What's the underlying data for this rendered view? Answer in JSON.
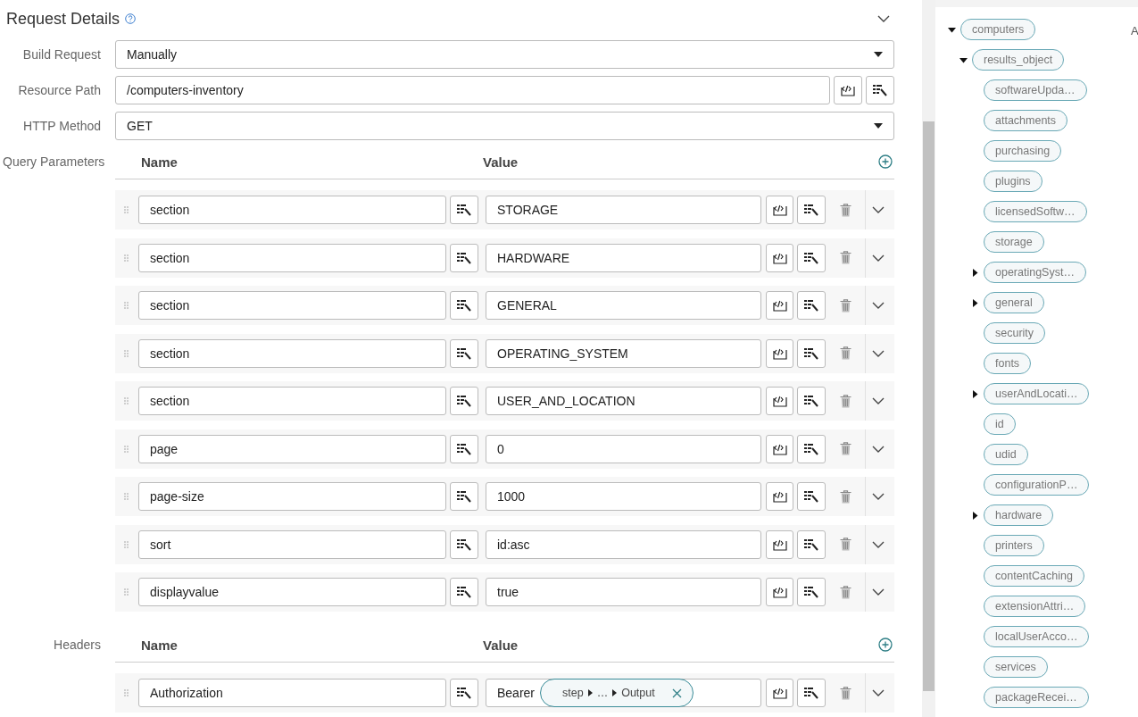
{
  "header": {
    "title": "Request Details",
    "expanded": true
  },
  "form": [
    {
      "label": "Build Request",
      "kind": "select",
      "value": "Manually"
    },
    {
      "label": "Resource Path",
      "kind": "text",
      "value": "/computers-inventory"
    },
    {
      "label": "HTTP Method",
      "kind": "select",
      "value": "GET"
    }
  ],
  "query_parameters": {
    "label": "Query Parameters",
    "columns": [
      "Name",
      "Value"
    ],
    "rows": [
      {
        "name": "section",
        "value": "STORAGE"
      },
      {
        "name": "section",
        "value": "HARDWARE"
      },
      {
        "name": "section",
        "value": "GENERAL"
      },
      {
        "name": "section",
        "value": "OPERATING_SYSTEM"
      },
      {
        "name": "section",
        "value": "USER_AND_LOCATION"
      },
      {
        "name": "page",
        "value": "0"
      },
      {
        "name": "page-size",
        "value": "1000"
      },
      {
        "name": "sort",
        "value": "id:asc"
      },
      {
        "name": "displayvalue",
        "value": "true"
      }
    ]
  },
  "headers": {
    "label": "Headers",
    "columns": [
      "Name",
      "Value"
    ],
    "rows": [
      {
        "name": "Authorization",
        "value": "Bearer",
        "token": {
          "parts": [
            "step",
            "…",
            "Output"
          ]
        }
      }
    ]
  },
  "output_variables": {
    "column_2": "A",
    "tree": [
      {
        "label": "computers",
        "kind": "branch",
        "expanded": true,
        "children": [
          {
            "label": "results_object",
            "kind": "branch",
            "expanded": true,
            "children": [
              {
                "label": "softwareUpda…",
                "kind": "leaf"
              },
              {
                "label": "attachments",
                "kind": "leaf"
              },
              {
                "label": "purchasing",
                "kind": "leaf"
              },
              {
                "label": "plugins",
                "kind": "leaf"
              },
              {
                "label": "licensedSoftw…",
                "kind": "leaf"
              },
              {
                "label": "storage",
                "kind": "leaf"
              },
              {
                "label": "operatingSyst…",
                "kind": "branch",
                "expanded": false
              },
              {
                "label": "general",
                "kind": "branch",
                "expanded": false
              },
              {
                "label": "security",
                "kind": "leaf"
              },
              {
                "label": "fonts",
                "kind": "leaf"
              },
              {
                "label": "userAndLocati…",
                "kind": "branch",
                "expanded": false
              },
              {
                "label": "id",
                "kind": "leaf"
              },
              {
                "label": "udid",
                "kind": "leaf"
              },
              {
                "label": "configurationP…",
                "kind": "leaf"
              },
              {
                "label": "hardware",
                "kind": "branch",
                "expanded": false
              },
              {
                "label": "printers",
                "kind": "leaf"
              },
              {
                "label": "contentCaching",
                "kind": "leaf"
              },
              {
                "label": "extensionAttri…",
                "kind": "leaf"
              },
              {
                "label": "localUserAcco…",
                "kind": "leaf"
              },
              {
                "label": "services",
                "kind": "leaf"
              },
              {
                "label": "packageRecei…",
                "kind": "leaf"
              }
            ]
          }
        ]
      }
    ]
  }
}
